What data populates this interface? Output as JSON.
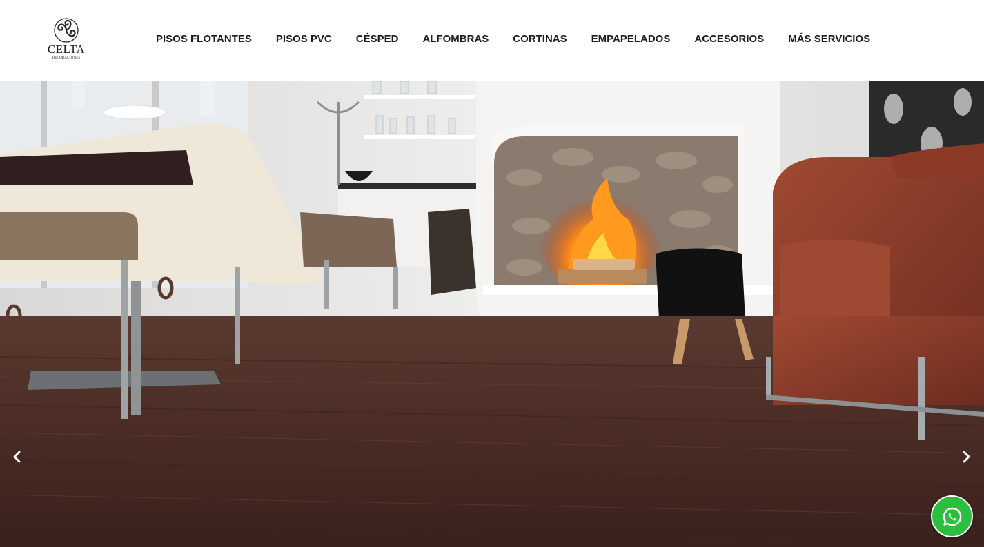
{
  "brand": {
    "name": "CELTA",
    "tagline": "DECORACIONES",
    "logo_icon": "triskelion-icon"
  },
  "nav": {
    "items": [
      {
        "label": "PISOS FLOTANTES"
      },
      {
        "label": "PISOS PVC"
      },
      {
        "label": "CÉSPED"
      },
      {
        "label": "ALFOMBRAS"
      },
      {
        "label": "CORTINAS"
      },
      {
        "label": "EMPAPELADOS"
      },
      {
        "label": "ACCESORIOS"
      },
      {
        "label": "MÁS SERVICIOS"
      }
    ]
  },
  "hero": {
    "image": "living room with fireplace and dark wood laminate floor",
    "prev_icon": "chevron-left-icon",
    "next_icon": "chevron-right-icon"
  },
  "floating": {
    "whatsapp_icon": "whatsapp-icon",
    "whatsapp_color": "#2bbf3f"
  }
}
